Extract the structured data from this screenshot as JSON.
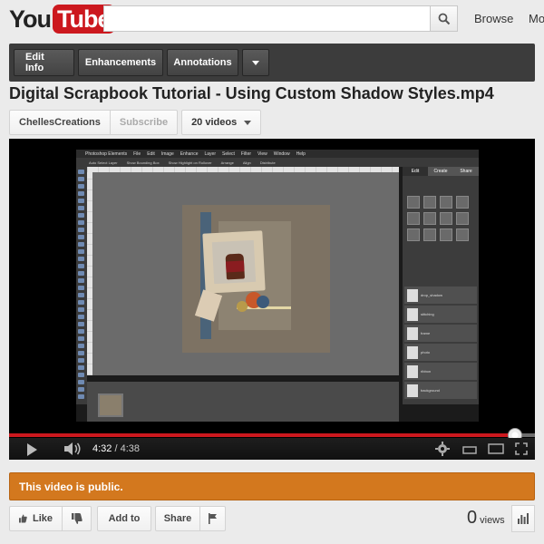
{
  "header": {
    "logo_you": "You",
    "logo_tube": "Tube",
    "search_placeholder": "",
    "browse_label": "Browse",
    "movies_label": "Mo"
  },
  "owner_bar": {
    "edit_info": "Edit Info",
    "enhancements": "Enhancements",
    "annotations": "Annotations"
  },
  "video": {
    "title": "Digital Scrapbook Tutorial - Using Custom Shadow Styles.mp4",
    "channel": "ChellesCreations",
    "subscribe": "Subscribe",
    "videos_count": "20 videos"
  },
  "screen": {
    "menu": [
      "Photoshop Elements",
      "File",
      "Edit",
      "Image",
      "Enhance",
      "Layer",
      "Select",
      "Filter",
      "View",
      "Window",
      "Help"
    ],
    "options": [
      "Auto Select Layer",
      "Show Bounding Box",
      "Show Highlight on Rollover",
      "Arrange",
      "Align",
      "Distribute"
    ],
    "panel_tabs": [
      "Edit",
      "Create",
      "Share"
    ],
    "layers": [
      "drop_shadow",
      "stitching",
      "frame",
      "photo",
      "ribbon",
      "background"
    ]
  },
  "player": {
    "current_time": "4:32",
    "duration": "4:38",
    "progress_fraction": 0.962
  },
  "notice": {
    "text": "This video is public."
  },
  "actions": {
    "like": "Like",
    "add_to": "Add to",
    "share": "Share"
  },
  "stats": {
    "view_count": "0",
    "views_label": "views"
  },
  "colors": {
    "brand_red": "#cc181e",
    "notice_orange": "#d3781e"
  }
}
